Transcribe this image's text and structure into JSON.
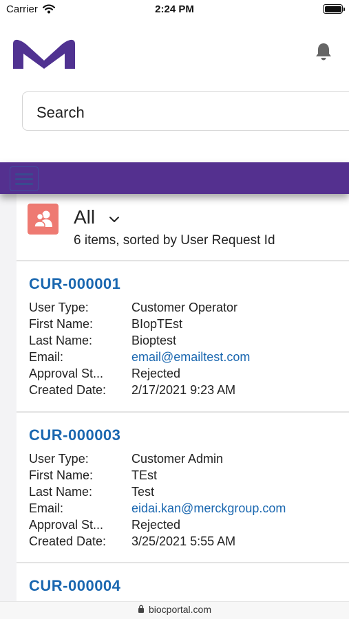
{
  "status_bar": {
    "carrier": "Carrier",
    "time": "2:24 PM"
  },
  "header": {
    "search_text": "Search"
  },
  "list": {
    "title": "All",
    "subtitle": "6 items, sorted by User Request Id"
  },
  "labels": {
    "user_type": "User Type:",
    "first_name": "First Name:",
    "last_name": "Last Name:",
    "email": "Email:",
    "approval": "Approval St...",
    "created": "Created Date:"
  },
  "records": [
    {
      "id": "CUR-000001",
      "user_type": "Customer Operator",
      "first_name": "BIopTEst",
      "last_name": "Bioptest",
      "email": "email@emailtest.com",
      "approval": "Rejected",
      "created": "2/17/2021 9:23 AM"
    },
    {
      "id": "CUR-000003",
      "user_type": "Customer Admin",
      "first_name": "TEst",
      "last_name": "Test",
      "email": "eidai.kan@merckgroup.com",
      "approval": "Rejected",
      "created": "3/25/2021 5:55 AM"
    },
    {
      "id": "CUR-000004"
    }
  ],
  "browser": {
    "url": "biocportal.com"
  },
  "colors": {
    "brand_purple": "#54308f",
    "logo_purple": "#503291",
    "link_blue": "#1a67b0",
    "object_icon_bg": "#ee7a72"
  },
  "icons": {
    "wifi": "wifi-icon",
    "battery": "battery-icon",
    "logo": "merck-m-logo",
    "bell": "bell-icon",
    "menu": "hamburger-menu-icon",
    "object": "users-object-icon",
    "chevron": "chevron-down-icon",
    "lock": "lock-icon"
  }
}
